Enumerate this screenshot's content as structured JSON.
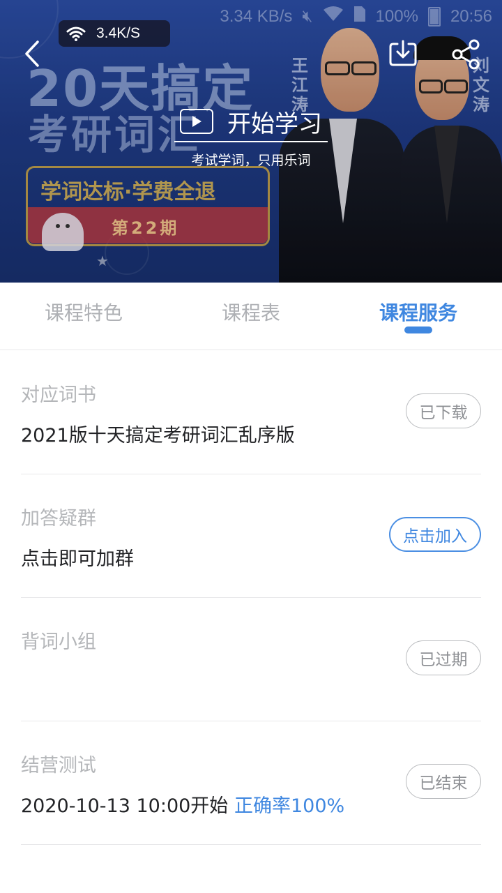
{
  "status_bar": {
    "net_speed": "3.34 KB/s",
    "battery": "100%",
    "time": "20:56"
  },
  "speed_overlay": {
    "value": "3.4K/S"
  },
  "banner": {
    "promo_title_line1": "20天搞定",
    "promo_title_line2": "考研词汇",
    "promo_slogan": "学词达标·学费全退",
    "promo_issue": "第22期",
    "teacher_left": "王江涛",
    "teacher_right": "刘文涛",
    "start_button_label": "开始学习",
    "subtitle": "考试学词，只用乐词"
  },
  "tabs": [
    {
      "label": "课程特色",
      "active": false
    },
    {
      "label": "课程表",
      "active": false
    },
    {
      "label": "课程服务",
      "active": true
    }
  ],
  "sections": [
    {
      "label": "对应词书",
      "value": "2021版十天搞定考研词汇乱序版",
      "extra": "",
      "button": "已下载",
      "button_style": "grey"
    },
    {
      "label": "加答疑群",
      "value": "点击即可加群",
      "extra": "",
      "button": "点击加入",
      "button_style": "blue"
    },
    {
      "label": "背词小组",
      "value": "",
      "extra": "",
      "button": "已过期",
      "button_style": "grey"
    },
    {
      "label": "结营测试",
      "value": "2020-10-13 10:00开始",
      "extra": "正确率100%",
      "button": "已结束",
      "button_style": "grey"
    }
  ],
  "colors": {
    "accent": "#3f87e0",
    "muted_text": "#b4b6b9",
    "primary_text": "#222326",
    "divider": "#e8e8ea"
  },
  "icons": [
    "back-arrow-icon",
    "download-icon",
    "share-icon",
    "play-icon",
    "wifi-icon"
  ]
}
